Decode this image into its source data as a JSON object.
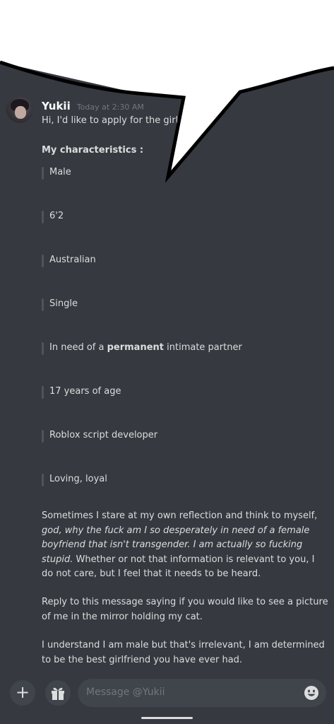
{
  "message": {
    "username": "Yukii",
    "timestamp": "Today at 2:30 AM",
    "intro": "Hi, I'd like to apply for the girlfrie                  n.",
    "characteristics_heading": "My characteristics :",
    "characteristics": [
      "Male",
      "6'2",
      "Australian",
      "Single",
      "In need of a permanent intimate partner",
      "17 years of age",
      "Roblox script developer",
      "Loving, loyal"
    ],
    "characteristic_5": {
      "before": "In need of a ",
      "bold": "permanent",
      "after": " intimate partner"
    },
    "paragraph1": {
      "before": "Sometimes I stare at my own reflection and think to myself, ",
      "italic": "god, why the fuck am I so desperately in need of a female boyfriend that isn't transgender. I am actually so fucking stupid.",
      "after": " Whether or not that information is relevant to you, I do not care, but I feel that it needs to be heard."
    },
    "paragraph2": "Reply to this message saying if you would like to see a picture of me in the mirror holding my cat.",
    "paragraph3": "I understand I am male but that's irrelevant, I am determined to be the best girlfriend you have ever had."
  },
  "composer": {
    "placeholder": "Message @Yukii",
    "plus_icon": "+",
    "gift_icon": "gift-icon",
    "emoji_icon": "emoji-icon"
  },
  "colors": {
    "background": "#36393f",
    "text": "#dcddde",
    "username": "#ffffff",
    "muted": "#72767d",
    "input_bg": "#40444b",
    "quote_bar": "#4f545c"
  }
}
